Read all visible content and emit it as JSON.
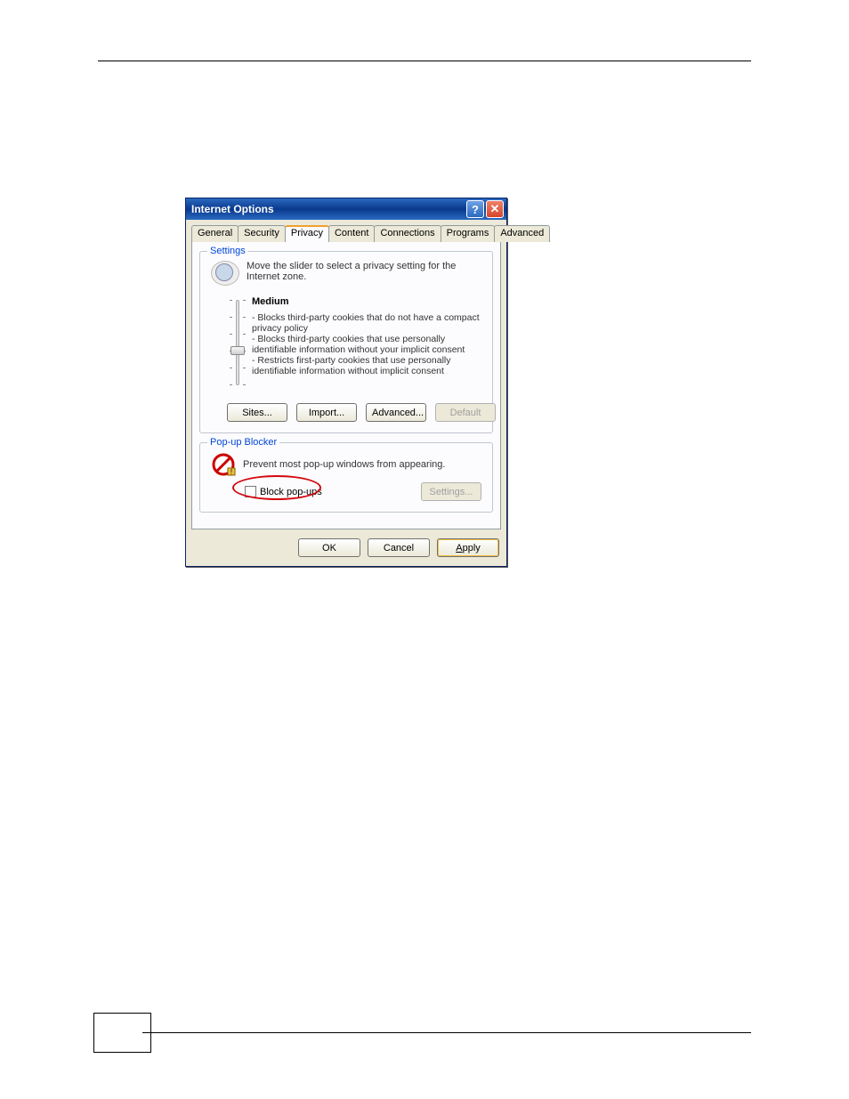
{
  "dialog": {
    "title": "Internet Options",
    "tabs": [
      {
        "label": "General"
      },
      {
        "label": "Security"
      },
      {
        "label": "Privacy",
        "active": true
      },
      {
        "label": "Content"
      },
      {
        "label": "Connections"
      },
      {
        "label": "Programs"
      },
      {
        "label": "Advanced"
      }
    ],
    "settings_group": {
      "title": "Settings",
      "instruction": "Move the slider to select a privacy setting for the Internet zone.",
      "level_name": "Medium",
      "level_desc": "- Blocks third-party cookies that do not have a compact privacy policy\n- Blocks third-party cookies that use personally identifiable information without your implicit consent\n- Restricts first-party cookies that use personally identifiable information without implicit consent",
      "buttons": {
        "sites": "Sites...",
        "import": "Import...",
        "advanced": "Advanced...",
        "default": "Default"
      }
    },
    "popup_group": {
      "title": "Pop-up Blocker",
      "instruction": "Prevent most pop-up windows from appearing.",
      "checkbox_label": "Block pop-ups",
      "settings_btn": "Settings..."
    },
    "footer_buttons": {
      "ok": "OK",
      "cancel": "Cancel",
      "apply": "Apply"
    }
  }
}
